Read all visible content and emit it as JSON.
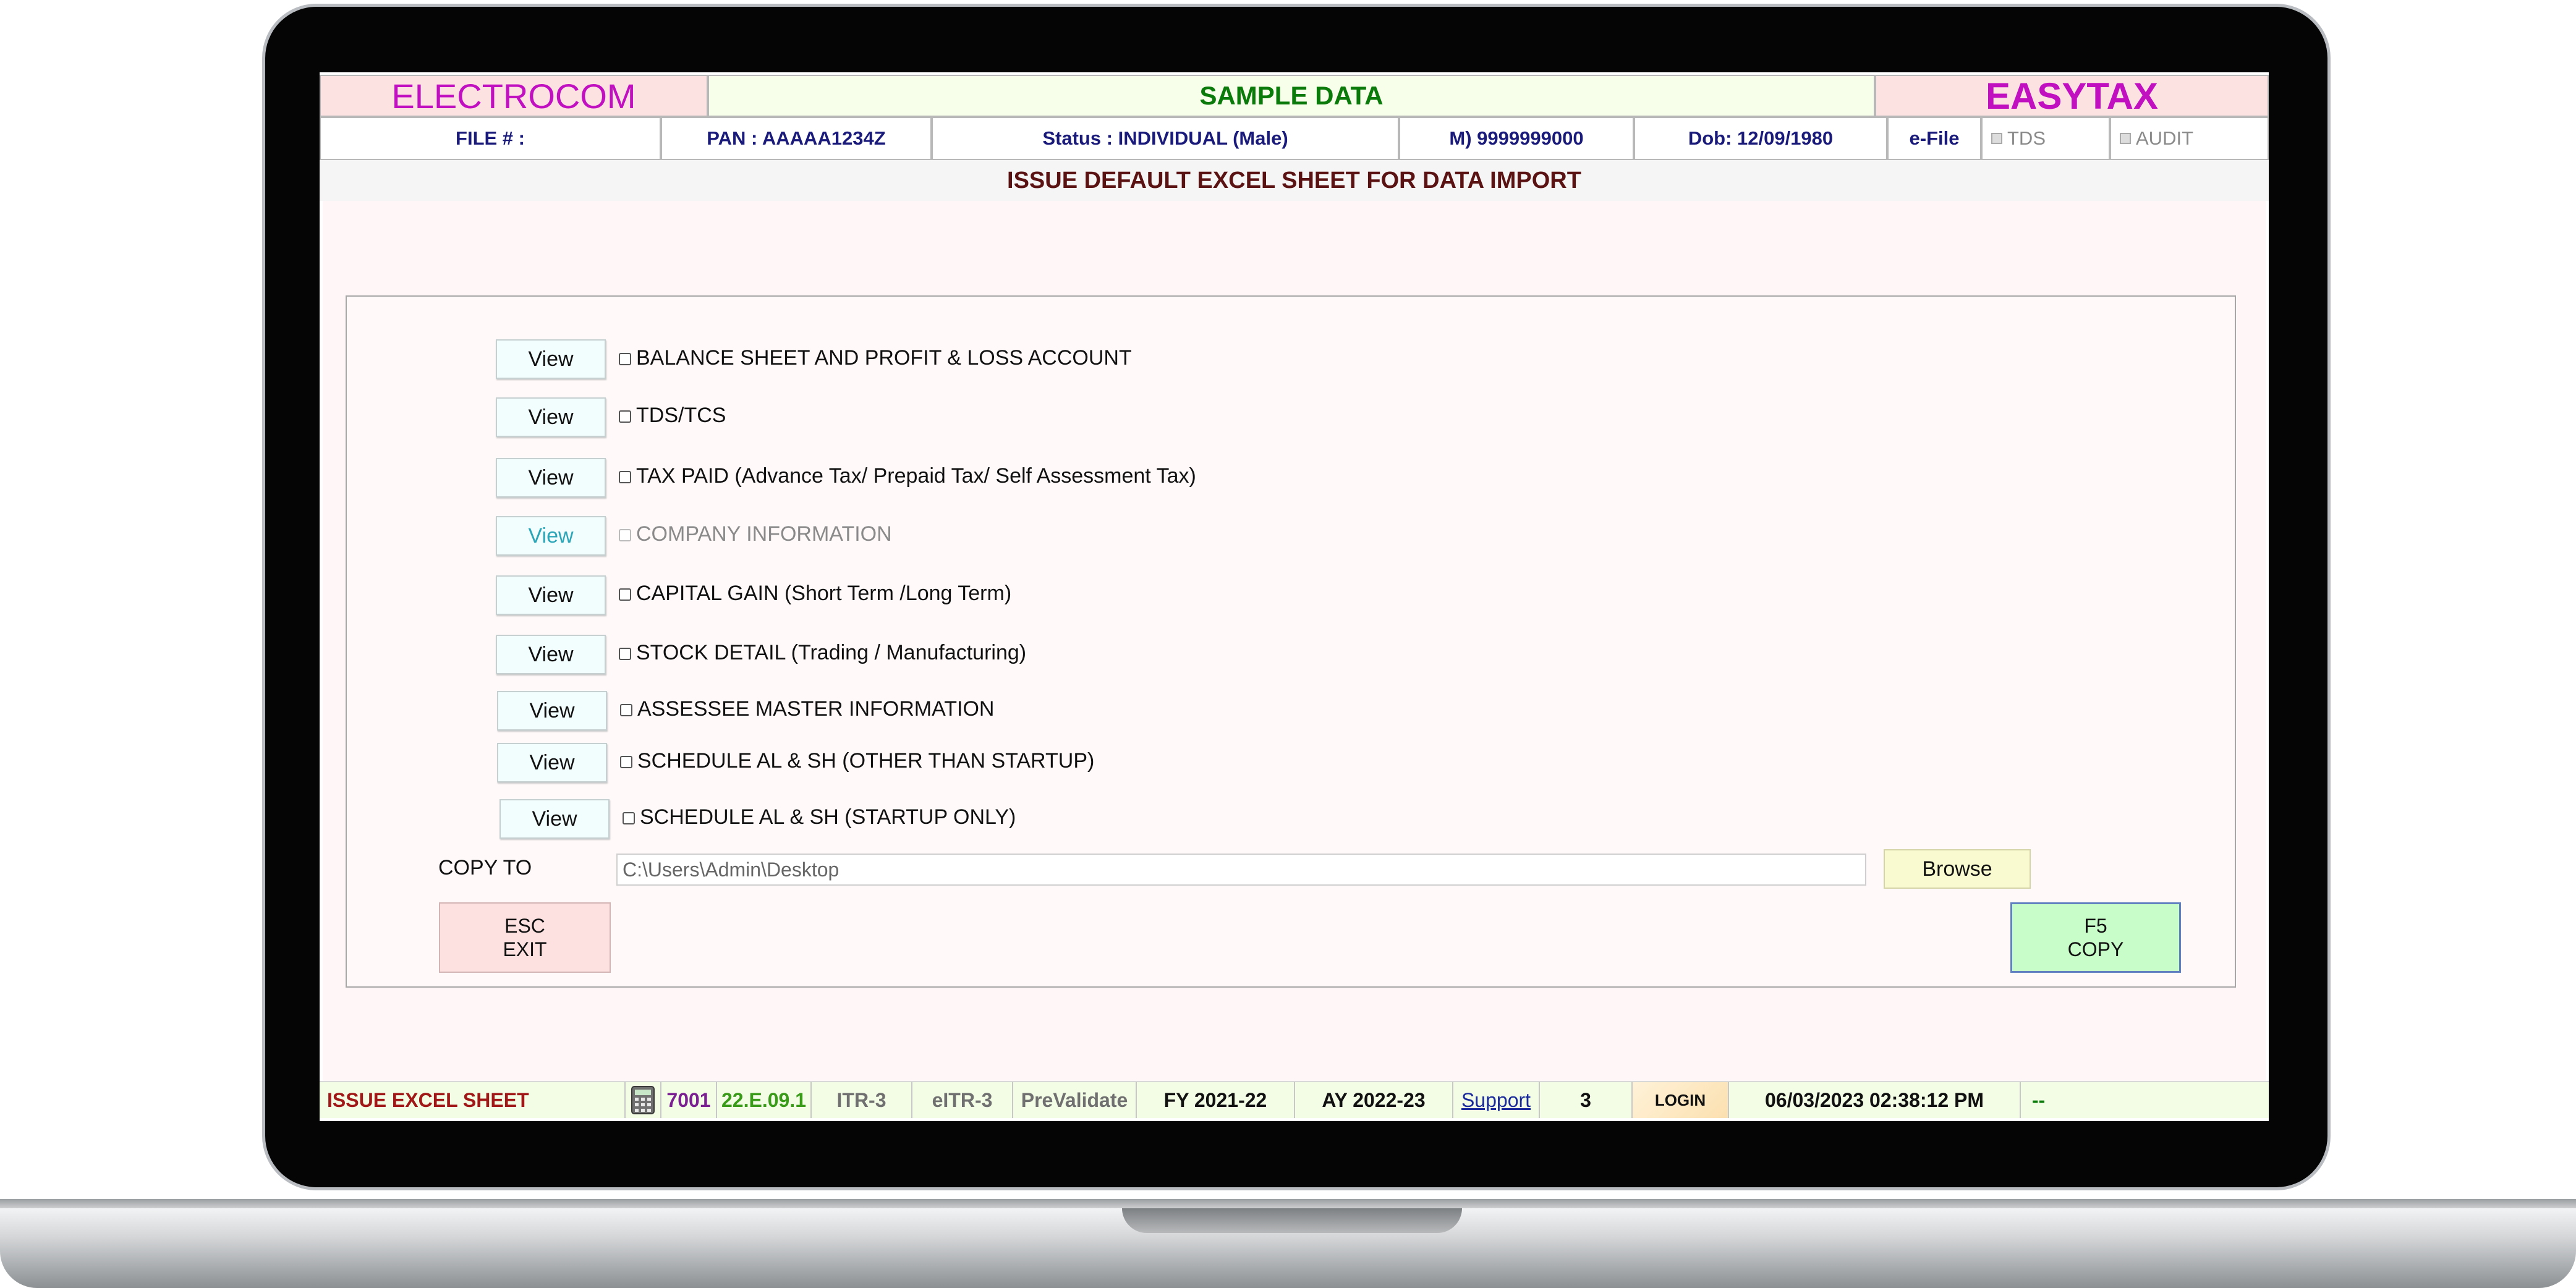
{
  "header": {
    "brand_left": "ELECTROCOM",
    "brand_center": "SAMPLE DATA",
    "brand_right": "EASYTAX"
  },
  "info_bar": {
    "file": "FILE # :",
    "pan": "PAN : AAAAA1234Z",
    "status": "Status : INDIVIDUAL (Male)",
    "mobile": "M) 9999999000",
    "dob": "Dob: 12/09/1980",
    "efile": "e-File",
    "tds": "TDS",
    "audit": "AUDIT"
  },
  "page_title": "ISSUE DEFAULT EXCEL SHEET FOR DATA IMPORT",
  "sheets": [
    {
      "button": "View",
      "label": "BALANCE SHEET AND PROFIT & LOSS ACCOUNT",
      "enabled": true
    },
    {
      "button": "View",
      "label": "TDS/TCS",
      "enabled": true
    },
    {
      "button": "View",
      "label": "TAX PAID (Advance Tax/ Prepaid Tax/ Self Assessment Tax)",
      "enabled": true
    },
    {
      "button": "View",
      "label": "COMPANY INFORMATION",
      "enabled": false
    },
    {
      "button": "View",
      "label": "CAPITAL GAIN (Short Term /Long Term)",
      "enabled": true
    },
    {
      "button": "View",
      "label": "STOCK DETAIL (Trading / Manufacturing)",
      "enabled": true
    },
    {
      "button": "View",
      "label": "ASSESSEE MASTER INFORMATION",
      "enabled": true
    },
    {
      "button": "View",
      "label": "SCHEDULE AL & SH (OTHER THAN STARTUP)",
      "enabled": true
    },
    {
      "button": "View",
      "label": "SCHEDULE AL & SH (STARTUP ONLY)",
      "enabled": true
    }
  ],
  "copy_to": {
    "label": "COPY TO",
    "path": "C:\\Users\\Admin\\Desktop",
    "browse_label": "Browse"
  },
  "actions": {
    "exit_key": "ESC",
    "exit_label": "EXIT",
    "copy_key": "F5",
    "copy_label": "COPY"
  },
  "status_bar": {
    "screen_name": "ISSUE EXCEL SHEET",
    "calculator_icon": "calculator-icon",
    "code": "7001",
    "version": "22.E.09.1",
    "itr": "ITR-3",
    "eitr": "eITR-3",
    "prevalidate": "PreValidate",
    "fy": "FY 2021-22",
    "ay": "AY 2022-23",
    "support": "Support",
    "count": "3",
    "login": "LOGIN",
    "datetime": "06/03/2023 02:38:12 PM",
    "extra": "--"
  },
  "colors": {
    "brand_magenta": "#c010c0",
    "brand_green": "#0a7a0a",
    "title_maroon": "#5a1212",
    "info_navy": "#1a1a7a",
    "status_red": "#a01818"
  }
}
